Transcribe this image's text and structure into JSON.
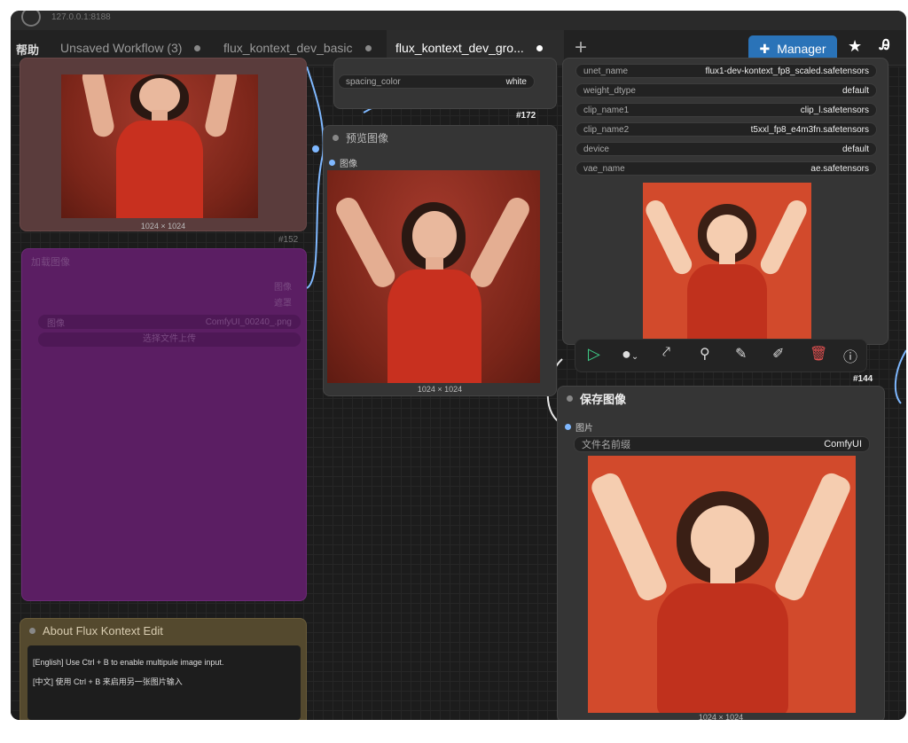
{
  "topbar": {
    "text": "127.0.0.1:8188"
  },
  "tabs": {
    "help": "帮助",
    "items": [
      {
        "label": "Unsaved Workflow (3)"
      },
      {
        "label": "flux_kontext_dev_basic"
      },
      {
        "label": "flux_kontext_dev_gro..."
      }
    ],
    "add": "+",
    "manager": "Manager",
    "star": "★",
    "lang": "Ꭿ"
  },
  "node_left_image": {
    "dims": "1024 × 1024",
    "id": "#152"
  },
  "node_load_image": {
    "title": "加载图像",
    "out1": "图像",
    "out2": "遮罩",
    "widget_label": "图像",
    "widget_value": "ComfyUI_00240_.png",
    "upload": "选择文件上传"
  },
  "node_about": {
    "title": "About Flux Kontext Edit",
    "line1": "[English] Use Ctrl + B to enable multipule image input.",
    "line2": "[中文] 使用 Ctrl + B 来启用另一张图片输入"
  },
  "node_spacing": {
    "label": "spacing_color",
    "value": "white",
    "id": "#172"
  },
  "node_preview": {
    "title": "预览图像",
    "input": "图像",
    "dims": "1024 × 1024"
  },
  "node_loader": {
    "widgets": [
      {
        "label": "unet_name",
        "value": "flux1-dev-kontext_fp8_scaled.safetensors"
      },
      {
        "label": "weight_dtype",
        "value": "default"
      },
      {
        "label": "clip_name1",
        "value": "clip_l.safetensors"
      },
      {
        "label": "clip_name2",
        "value": "t5xxl_fp8_e4m3fn.safetensors"
      },
      {
        "label": "device",
        "value": "default"
      },
      {
        "label": "vae_name",
        "value": "ae.safetensors"
      }
    ],
    "id": "#144"
  },
  "node_save": {
    "title": "保存图像",
    "input": "图片",
    "prefix_label": "文件名前缀",
    "prefix_value": "ComfyUI",
    "dims": "1024 × 1024"
  },
  "toolbar": {
    "icons": [
      "play-icon",
      "color-icon",
      "bypass-icon",
      "pin-icon",
      "edit-icon",
      "pencil-icon",
      "trash-icon",
      "help-icon"
    ]
  }
}
